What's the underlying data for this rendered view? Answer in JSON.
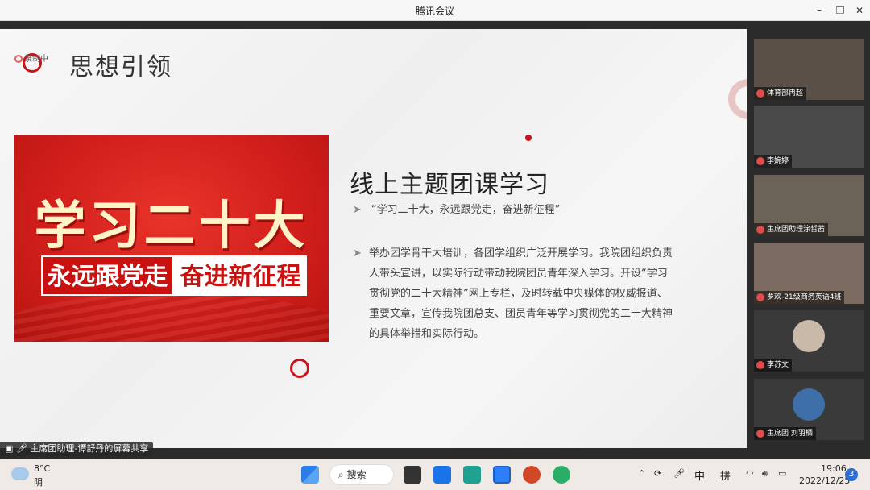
{
  "window": {
    "title": "腾讯会议",
    "controls": {
      "minimize": "–",
      "restore": "❐",
      "close": "✕"
    }
  },
  "slide": {
    "rec_badge": "录制中",
    "title": "思想引领",
    "banner": {
      "line1": "学习二十大",
      "strip_left": "永远跟党走",
      "strip_right": "奋进新征程"
    },
    "heading": "线上主题团课学习",
    "bullet_glyph": "➤",
    "quote": "“学习二十大，永远跟党走，奋进新征程”",
    "paragraph": "举办团学骨干大培训，各团学组织广泛开展学习。我院团组织负责人带头宣讲，以实际行动带动我院团员青年深入学习。开设“学习贯彻党的二十大精神”网上专栏，及时转载中央媒体的权威报道、重要文章，宣传我院团总支、团员青年等学习贯彻党的二十大精神的具体举措和实际行动。",
    "accent_color": "#c9121a"
  },
  "share_bar": {
    "label": "主席团助理-谭舒丹的屏幕共享"
  },
  "participants": [
    {
      "name": "体育部冉超",
      "bg": "#5a5048"
    },
    {
      "name": "李婉婷",
      "bg": "#4a4a4a"
    },
    {
      "name": "主席团助理涂皙茜",
      "bg": "#6b6258"
    },
    {
      "name": "罗欢-21级商务英语4班",
      "bg": "#7a6a60"
    },
    {
      "name": "李苏文",
      "bg": "#3a3a3a"
    },
    {
      "name": "主席团 刘羽栖",
      "bg": "#3a3a3a"
    }
  ],
  "taskbar": {
    "weather_temp": "8°C",
    "weather_desc": "阴",
    "search_label": "搜索",
    "ime_lang": "中",
    "ime_mode": "拼",
    "time": "19:06",
    "date": "2022/12/25",
    "notif_count": "3"
  }
}
